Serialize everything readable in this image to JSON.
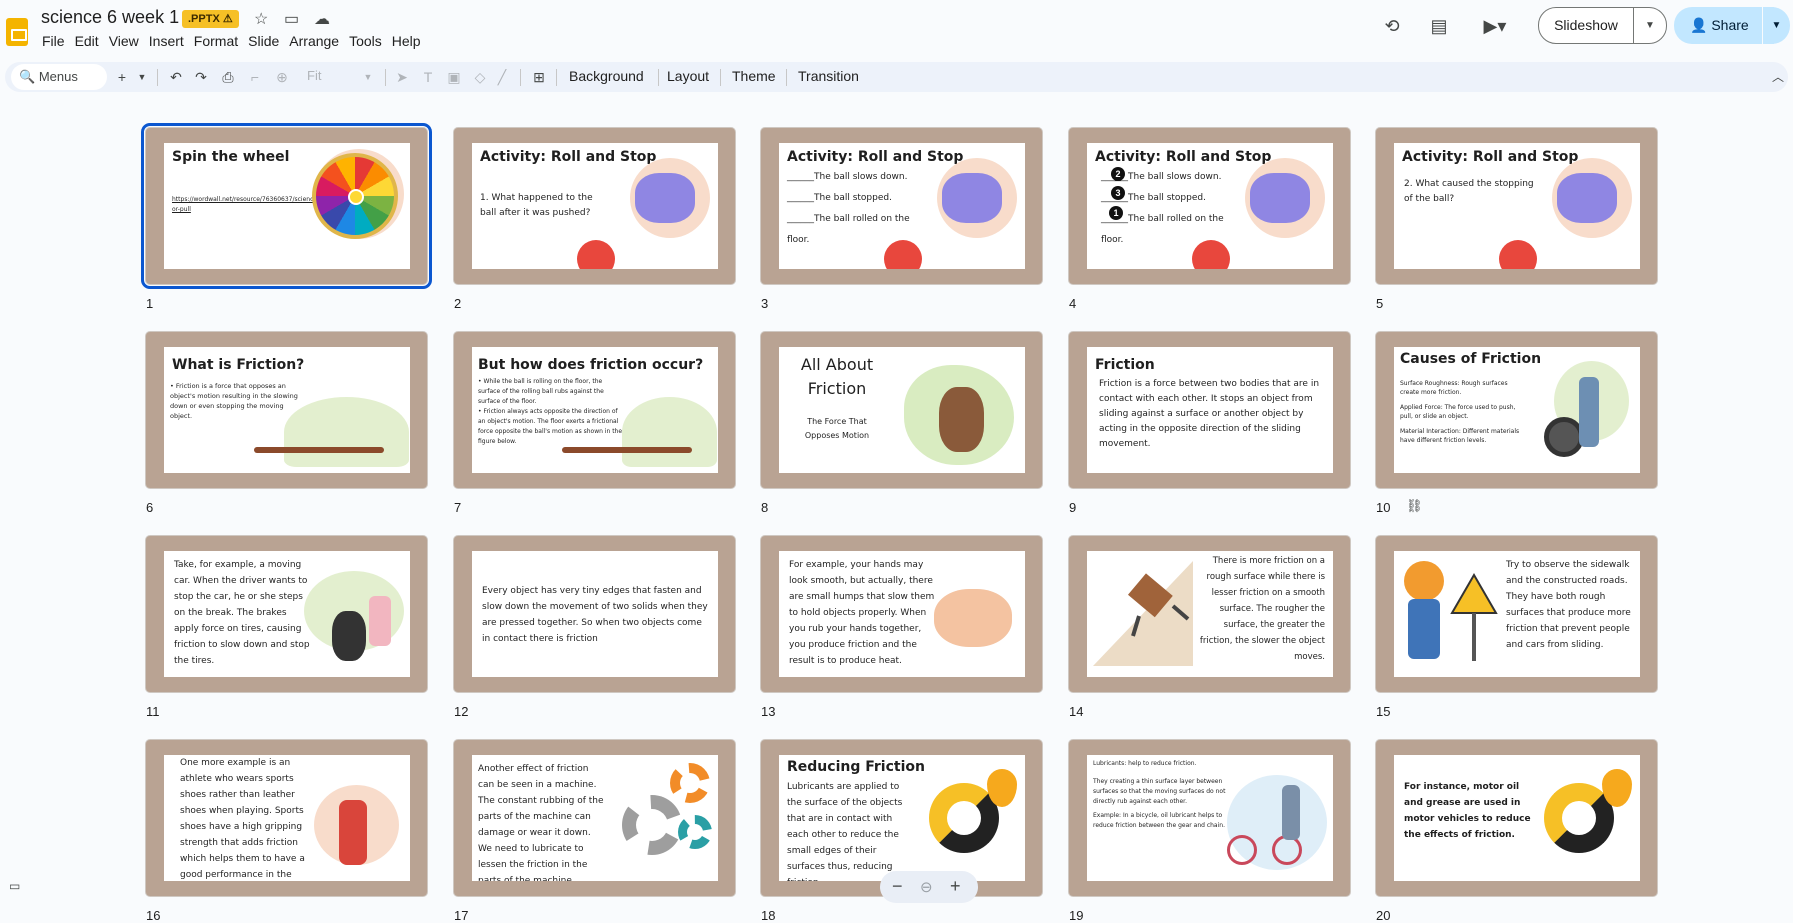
{
  "app": {
    "doc_title": "science 6 week 1",
    "badge": ".PPTX ⚠",
    "menus": [
      "File",
      "Edit",
      "View",
      "Insert",
      "Format",
      "Slide",
      "Arrange",
      "Tools",
      "Help"
    ],
    "slideshow_label": "Slideshow",
    "share_label": "Share"
  },
  "toolbar": {
    "search_label": "Menus",
    "fit_label": "Fit",
    "background_label": "Background",
    "layout_label": "Layout",
    "theme_label": "Theme",
    "transition_label": "Transition"
  },
  "slides": [
    {
      "num": "1",
      "title": "Spin the wheel",
      "text": "https://wordwall.net/resource/76360637/science/push-or-pull"
    },
    {
      "num": "2",
      "title": "Activity: Roll and Stop",
      "text": "1. What happened to the ball after it was pushed?"
    },
    {
      "num": "3",
      "title": "Activity: Roll and Stop",
      "lines": [
        "______The ball slows down.",
        "______The ball stopped.",
        "______The ball rolled on the floor."
      ]
    },
    {
      "num": "4",
      "title": "Activity: Roll and Stop",
      "lines": [
        "______The ball slows down.",
        "______The ball stopped.",
        "______The ball rolled on the floor."
      ],
      "markers": [
        "2",
        "3",
        "1"
      ]
    },
    {
      "num": "5",
      "title": "Activity: Roll and Stop",
      "text": "2. What caused the stopping of the ball?"
    },
    {
      "num": "6",
      "title": "What is Friction?",
      "text": "• Friction is a force that opposes an object's motion resulting in the slowing down or even stopping the moving object."
    },
    {
      "num": "7",
      "title": "But how does friction occur?",
      "bullets": [
        "While the ball is rolling on the floor, the surface of the rolling ball rubs against the surface of the floor.",
        "Friction always acts opposite the direction of an object's motion. The floor exerts a frictional force opposite the ball's motion as shown in the figure below."
      ]
    },
    {
      "num": "8",
      "title": "All About Friction",
      "subtitle": "The Force That Opposes Motion"
    },
    {
      "num": "9",
      "title": "Friction",
      "text": "Friction is a force between two bodies that are in contact with each other. It stops an object from sliding against a surface or another object by acting in the opposite direction of the sliding movement."
    },
    {
      "num": "10",
      "title": "Causes of Friction",
      "items": [
        "Surface Roughness: Rough surfaces create more friction.",
        "Applied Force: The force used to push, pull, or slide an object.",
        "Material Interaction: Different materials have different friction levels."
      ]
    },
    {
      "num": "11",
      "text": "Take, for example, a moving car. When the driver wants to stop the car, he or she steps on the break. The brakes apply force on tires, causing friction to slow down and stop the tires."
    },
    {
      "num": "12",
      "text": "Every object has very tiny edges that fasten and slow down the movement of two solids when they are pressed together. So when two objects come in contact there is friction"
    },
    {
      "num": "13",
      "text": "For example, your hands may look smooth, but actually, there are small humps that slow them to hold objects properly. When you rub your hands together, you produce friction and the result is to produce heat."
    },
    {
      "num": "14",
      "text": "There is more friction on a rough surface while there is lesser friction on a smooth surface. The rougher the surface, the greater the friction, the slower the object moves."
    },
    {
      "num": "15",
      "text": "Try to observe the sidewalk and the constructed roads. They have both rough surfaces that produce more friction that prevent people and cars from sliding."
    },
    {
      "num": "16",
      "text": "One more example is an athlete who wears sports shoes rather than leather shoes when playing. Sports shoes have a high gripping strength that adds friction which helps them to have a good performance in the game."
    },
    {
      "num": "17",
      "text": "Another effect of friction can be seen in a machine. The constant rubbing of the parts of the machine can damage or wear it down. We need to lubricate to lessen the friction in the parts of the machine."
    },
    {
      "num": "18",
      "title": "Reducing Friction",
      "text": "Lubricants are applied to the surface of the objects that are in contact with each other to reduce the small edges of their surfaces thus, reducing friction"
    },
    {
      "num": "19",
      "lines": [
        "Lubricants: help to reduce friction.",
        "They creating a thin surface layer between surfaces so that the moving surfaces do not directly rub against each other.",
        "Example: In a bicycle, oil lubricant helps to reduce friction between the gear and chain."
      ]
    },
    {
      "num": "20",
      "text": "For instance, motor oil and grease are used in motor vehicles to reduce the effects of friction."
    }
  ],
  "colors": {
    "accent": "#0b57d0",
    "slide_frame": "#b9a393",
    "share_bg": "#c2e7ff",
    "badge_bg": "#f6c026"
  }
}
